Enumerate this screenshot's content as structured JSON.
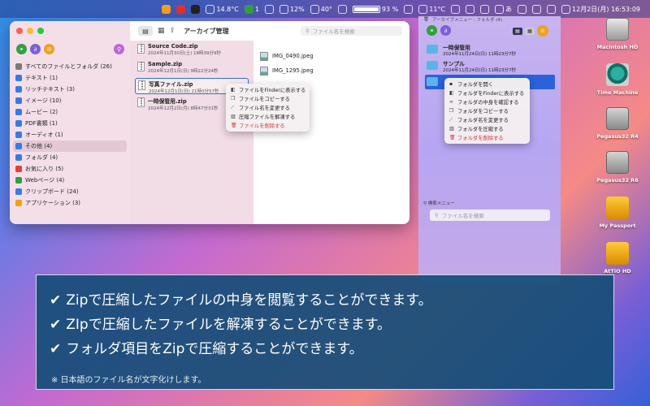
{
  "menubar": {
    "items": [
      {
        "label": "",
        "icon": "mic-icon",
        "color": "#f0a020"
      },
      {
        "label": "",
        "icon": "link-icon",
        "color": "#e03030"
      },
      {
        "label": "",
        "icon": "record-icon",
        "color": "#222222"
      },
      {
        "label": "14.8°C",
        "icon": "temp-icon"
      },
      {
        "label": "1",
        "icon": "badge-icon",
        "color": "#30a040"
      },
      {
        "label": "",
        "icon": "cpu-graph-icon"
      },
      {
        "label": "12%",
        "icon": "cpu-icon"
      },
      {
        "label": "40°",
        "icon": "fan-icon"
      },
      {
        "label": "",
        "icon": "network-icon"
      },
      {
        "label": "93 %",
        "icon": "battery-icon"
      },
      {
        "label": "",
        "icon": "calendar-icon"
      },
      {
        "label": "11°C",
        "icon": "weather-icon"
      },
      {
        "label": "",
        "icon": "dropbox-icon"
      },
      {
        "label": "",
        "icon": "display-icon"
      },
      {
        "label": "",
        "icon": "time-machine-icon"
      },
      {
        "label": "あ",
        "icon": "input-icon"
      },
      {
        "label": "",
        "icon": "wifi-icon"
      },
      {
        "label": "",
        "icon": "search-icon"
      },
      {
        "label": "",
        "icon": "control-center-icon"
      },
      {
        "label": "12月2日(月) 16:53:09",
        "icon": "clock-icon"
      }
    ]
  },
  "window": {
    "title": "アーカイブ管理",
    "search_placeholder": "ファイル名を検索",
    "sidebar": [
      {
        "label": "すべてのファイルとフォルダ (26)",
        "color": "#7a7a7a"
      },
      {
        "label": "テキスト (1)",
        "color": "#3a7ae0"
      },
      {
        "label": "リッチテキスト (3)",
        "color": "#3a7ae0"
      },
      {
        "label": "イメージ (10)",
        "color": "#3a7ae0"
      },
      {
        "label": "ムービー (2)",
        "color": "#3a7ae0"
      },
      {
        "label": "PDF書類 (1)",
        "color": "#3a7ae0"
      },
      {
        "label": "オーディオ (1)",
        "color": "#3a7ae0"
      },
      {
        "label": "その他 (4)",
        "color": "#3a7ae0",
        "selected": true
      },
      {
        "label": "フォルダ (4)",
        "color": "#3a7ae0"
      },
      {
        "label": "お気に入り (5)",
        "color": "#e04040"
      },
      {
        "label": "Webページ (4)",
        "color": "#30a040"
      },
      {
        "label": "クリップボード (24)",
        "color": "#3a7ae0"
      },
      {
        "label": "アプリケーション (3)",
        "color": "#f0a020"
      }
    ],
    "files": [
      {
        "name": "Source Code.zip",
        "date": "2024年11月30日(土) 18時39分9秒"
      },
      {
        "name": "Sample.zip",
        "date": "2024年12月1日(日) 9時22分24秒"
      },
      {
        "name": "写真ファイル.zip",
        "date": "2024年12月1日(日) 21時0分57秒",
        "selected": true
      },
      {
        "name": "一時保管用.zip",
        "date": "2024年12月2日(月) 8時47分31秒"
      }
    ],
    "images": [
      {
        "name": "IMG_0490.jpeg"
      },
      {
        "name": "IMG_1295.jpeg"
      }
    ],
    "context_menu": [
      {
        "label": "ファイルをFinderに表示する",
        "icon": "finder-icon"
      },
      {
        "label": "ファイルをコピーする",
        "icon": "copy-icon"
      },
      {
        "label": "ファイル名を変更する",
        "icon": "pencil-icon"
      },
      {
        "label": "圧縮ファイルを解凍する",
        "icon": "archive-icon"
      },
      {
        "label": "ファイルを削除する",
        "icon": "trash-icon",
        "danger": true
      }
    ]
  },
  "right_panel": {
    "header": "アーカイブメニュー : フォルダ (4)",
    "folders": [
      {
        "name": "一時保管用",
        "date": "2024年11月24日(日) 11時23分7秒"
      },
      {
        "name": "サンプル",
        "date": "2024年11月24日(日) 11時23分7秒"
      },
      {
        "name": "",
        "date": "",
        "selected": true
      }
    ],
    "context_menu": [
      {
        "label": "フォルダを開く",
        "icon": "open-icon"
      },
      {
        "label": "フォルダをFinderに表示する",
        "icon": "finder-icon"
      },
      {
        "label": "フォルダの中身を確認する",
        "icon": "glasses-icon"
      },
      {
        "label": "フォルダをコピーする",
        "icon": "copy-icon"
      },
      {
        "label": "フォルダ名を変更する",
        "icon": "pencil-icon"
      },
      {
        "label": "フォルダを圧縮する",
        "icon": "archive-icon"
      },
      {
        "label": "フォルダを削除する",
        "icon": "trash-icon",
        "danger": true
      }
    ],
    "search_title": "検索メニュー",
    "search_placeholder": "ファイル名を検索"
  },
  "desktop": [
    {
      "label": "Macintosh HD",
      "kind": "hd"
    },
    {
      "label": "Time Machine",
      "kind": "tm"
    },
    {
      "label": "Pegasus32 R4",
      "kind": "peg"
    },
    {
      "label": "Pegasus32 R6",
      "kind": "peg"
    },
    {
      "label": "My Passport",
      "kind": "mp"
    },
    {
      "label": "AtTiO HD",
      "kind": "mp"
    }
  ],
  "caption": {
    "lines": [
      "Zipで圧縮したファイルの中身を閲覧することができます。",
      "ZIpで圧縮したファイルを解凍することができます。",
      "フォルダ項目をZipで圧縮することができます。"
    ],
    "check": "✔",
    "note": "※ 日本語のファイル名が文字化けします。"
  }
}
